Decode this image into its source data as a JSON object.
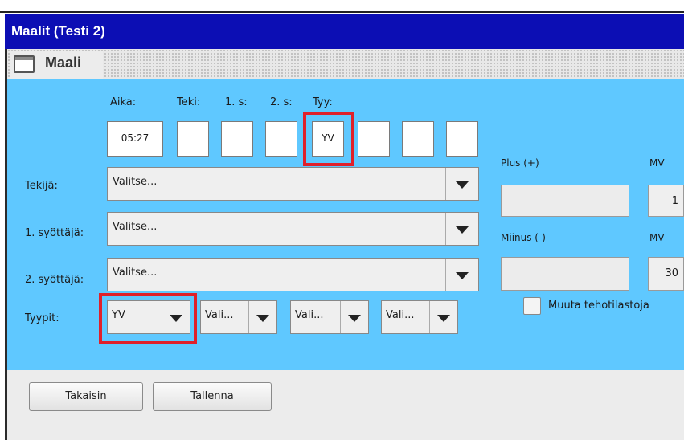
{
  "window": {
    "title": "Maalit (Testi 2)",
    "top_fragment": "",
    "panel_title": "Maali"
  },
  "time_row": {
    "headers": {
      "time": "Aika:",
      "scorer": "Teki:",
      "assist1": "1. s:",
      "assist2": "2. s:",
      "type": "Tyy:"
    },
    "fields": [
      "05:27",
      "",
      "",
      "",
      "YV",
      "",
      "",
      ""
    ]
  },
  "form": {
    "scorer_label": "Tekijä:",
    "assist1_label": "1. syöttäjä:",
    "assist2_label": "2. syöttäjä:",
    "types_label": "Tyypit:",
    "scorer_value": "Valitse...",
    "assist1_value": "Valitse...",
    "assist2_value": "Valitse...",
    "types": [
      "YV",
      "Vali...",
      "Vali...",
      "Vali..."
    ]
  },
  "right_panel": {
    "plus_label": "Plus (+)",
    "minus_label": "Miinus (-)",
    "mv_label": "MV",
    "mv_plus_value": "1",
    "mv_minus_value": "30",
    "checkbox_label": "Muuta tehotilastoja",
    "checkbox_checked": false
  },
  "buttons": {
    "back": "Takaisin",
    "save": "Tallenna"
  },
  "colors": {
    "titlebar": "#0c0eb4",
    "panel": "#5fc8ff",
    "highlight": "#e0202a"
  }
}
